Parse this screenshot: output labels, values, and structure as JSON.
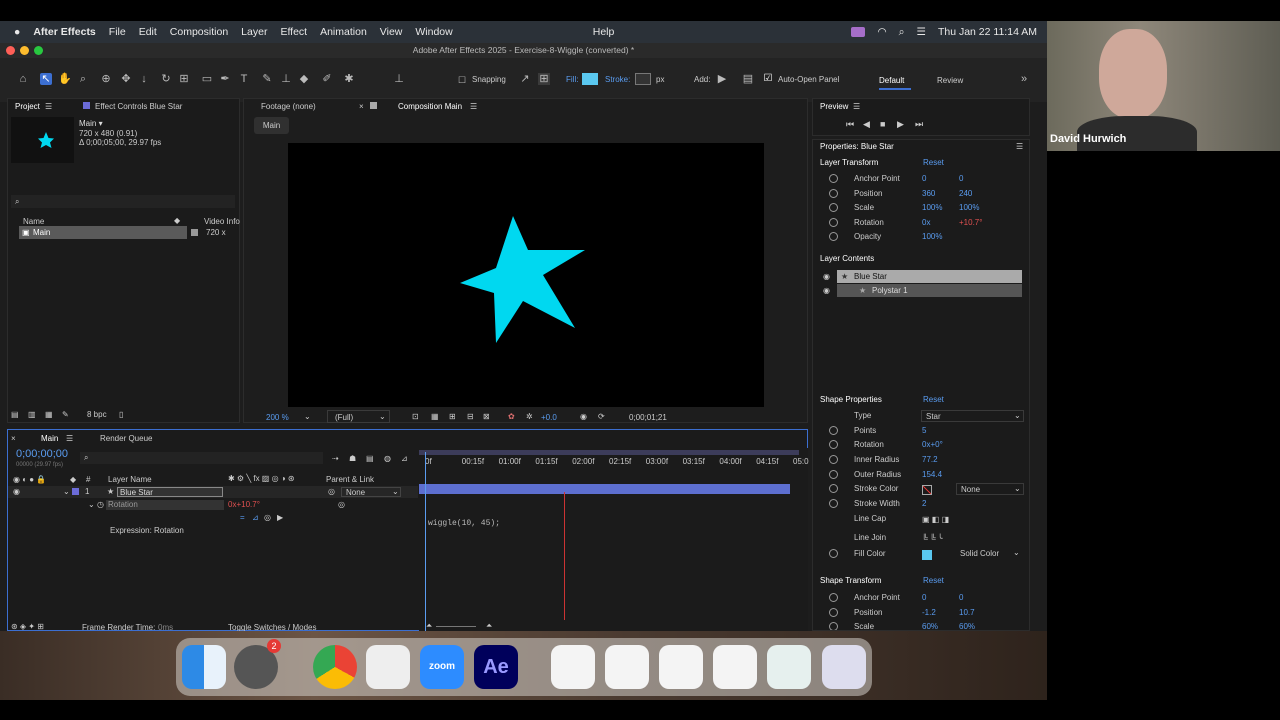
{
  "menubar": {
    "app": "After Effects",
    "items": [
      "File",
      "Edit",
      "Composition",
      "Layer",
      "Effect",
      "Animation",
      "View",
      "Window",
      "Help"
    ],
    "clock": "Thu Jan 22  11:14 AM"
  },
  "window": {
    "title": "Adobe After Effects 2025 - Exercise-8-Wiggle (converted) *"
  },
  "toolbar": {
    "snapping": "Snapping",
    "fill": "Fill:",
    "stroke": "Stroke:",
    "px": "px",
    "add": "Add:",
    "auto_open": "Auto-Open Panel",
    "workspace_default": "Default",
    "workspace_review": "Review"
  },
  "project": {
    "tab": "Project",
    "effect_tab": "Effect Controls Blue Star",
    "comp_name": "Main ▾",
    "comp_size": "720 x 480 (0.91)",
    "comp_dur": "Δ 0;00;05;00, 29.97 fps",
    "col_name": "Name",
    "col_info": "Video Info",
    "item_name": "Main",
    "item_info": "720 x",
    "bpc": "8 bpc"
  },
  "viewer": {
    "footage_tab": "Footage (none)",
    "comp_tab": "Composition Main",
    "breadcrumb": "Main",
    "zoom": "200 %",
    "quality": "(Full)",
    "exposure": "+0.0",
    "timecode": "0;00;01;21",
    "star_color": "#00d8f0"
  },
  "timeline": {
    "tab": "Main",
    "render_tab": "Render Queue",
    "timecode": "0;00;00;00",
    "fps": "00000 (29.97 fps)",
    "col_layer": "Layer Name",
    "col_parent": "Parent & Link",
    "layer_num": "1",
    "layer_name": "Blue Star",
    "parent": "None",
    "rotation": "Rotation",
    "rotation_val": "0x+10.7°",
    "expression_label": "Expression: Rotation",
    "expression": "wiggle(10, 45);",
    "ticks": [
      "0f",
      "00:15f",
      "01:00f",
      "01:15f",
      "02:00f",
      "02:15f",
      "03:00f",
      "03:15f",
      "04:00f",
      "04:15f",
      "05:0"
    ],
    "frame_render": "Frame Render Time:",
    "frame_render_val": "0ms",
    "toggle": "Toggle Switches / Modes"
  },
  "preview": {
    "title": "Preview"
  },
  "properties": {
    "title": "Properties: Blue Star",
    "layer_transform": "Layer Transform",
    "reset": "Reset",
    "lt": [
      {
        "label": "Anchor Point",
        "v1": "0",
        "v2": "0"
      },
      {
        "label": "Position",
        "v1": "360",
        "v2": "240"
      },
      {
        "label": "Scale",
        "v1": "100%",
        "v2": "100%"
      },
      {
        "label": "Rotation",
        "v1": "0x",
        "v2": "+10.7°"
      },
      {
        "label": "Opacity",
        "v1": "100%",
        "v2": ""
      }
    ],
    "layer_contents": "Layer Contents",
    "lc_items": [
      "Blue Star",
      "Polystar 1"
    ],
    "shape_props": "Shape Properties",
    "sp": [
      {
        "label": "Type",
        "v": "Star"
      },
      {
        "label": "Points",
        "v": "5"
      },
      {
        "label": "Rotation",
        "v": "0x+0°"
      },
      {
        "label": "Inner Radius",
        "v": "77.2"
      },
      {
        "label": "Outer Radius",
        "v": "154.4"
      },
      {
        "label": "Stroke Color",
        "v": "None"
      },
      {
        "label": "Stroke Width",
        "v": "2"
      },
      {
        "label": "Line Cap",
        "v": ""
      },
      {
        "label": "Line Join",
        "v": ""
      },
      {
        "label": "Fill Color",
        "v": "Solid Color"
      }
    ],
    "shape_transform": "Shape Transform",
    "st": [
      {
        "label": "Anchor Point",
        "v1": "0",
        "v2": "0"
      },
      {
        "label": "Position",
        "v1": "-1.2",
        "v2": "10.7"
      },
      {
        "label": "Scale",
        "v1": "60%",
        "v2": "60%"
      }
    ]
  },
  "webcam": {
    "name": "David Hurwich"
  },
  "dock": {
    "badge": "2",
    "zoom_label": "zoom",
    "ae_label": "Ae"
  }
}
